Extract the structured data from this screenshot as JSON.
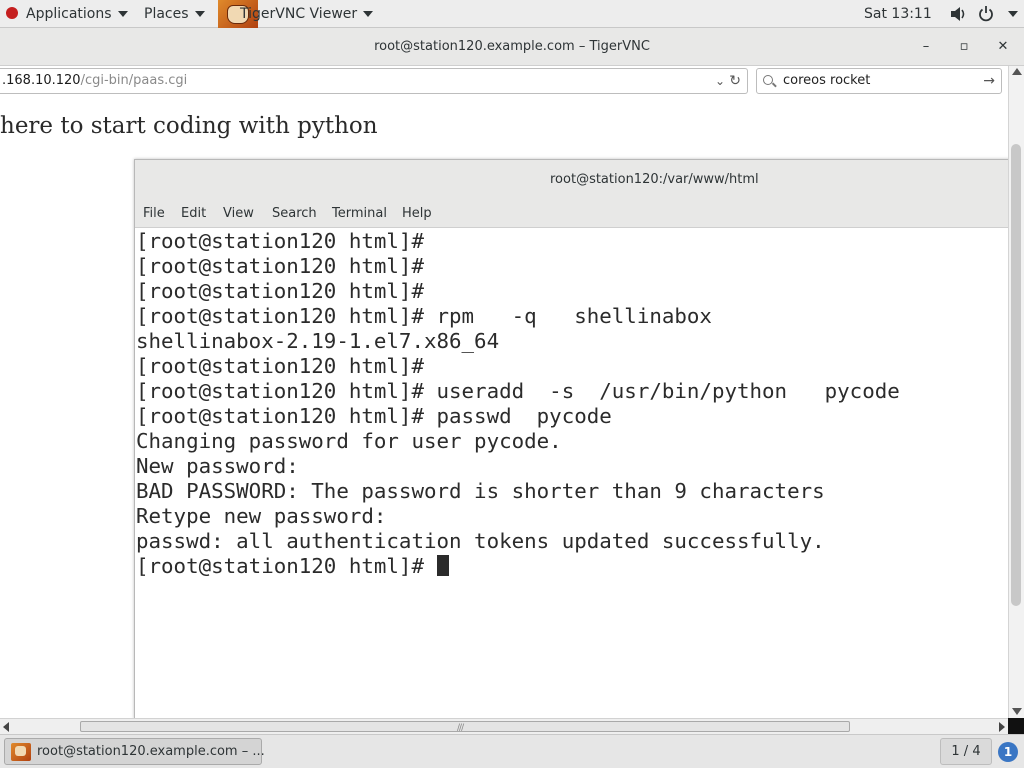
{
  "topbar": {
    "applications": "Applications",
    "places": "Places",
    "active_app": "TigerVNC Viewer",
    "clock": "Sat 13:11",
    "icons": [
      "volume-icon",
      "power-icon"
    ]
  },
  "vnc_window": {
    "title": "root@station120.example.com – TigerVNC",
    "minimize": "–",
    "maximize": "▫",
    "close": "✕"
  },
  "browser": {
    "url_host": ".168.10.120",
    "url_path": "/cgi-bin/paas.cgi",
    "search_value": "coreos rocket",
    "page_heading": "here to start coding with python"
  },
  "terminal": {
    "title": "root@station120:/var/www/html",
    "menu": [
      "File",
      "Edit",
      "View",
      "Search",
      "Terminal",
      "Help"
    ],
    "lines": [
      "[root@station120 html]#",
      "[root@station120 html]#",
      "[root@station120 html]#",
      "[root@station120 html]# rpm   -q   shellinabox",
      "shellinabox-2.19-1.el7.x86_64",
      "[root@station120 html]#",
      "[root@station120 html]# useradd  -s  /usr/bin/python   pycode",
      "[root@station120 html]# passwd  pycode",
      "Changing password for user pycode.",
      "New password:",
      "BAD PASSWORD: The password is shorter than 9 characters",
      "Retype new password:",
      "passwd: all authentication tokens updated successfully.",
      "[root@station120 html]# "
    ]
  },
  "taskbar": {
    "window_label": "root@station120.example.com – ...",
    "workspace": "1 / 4",
    "notification_count": "1"
  }
}
